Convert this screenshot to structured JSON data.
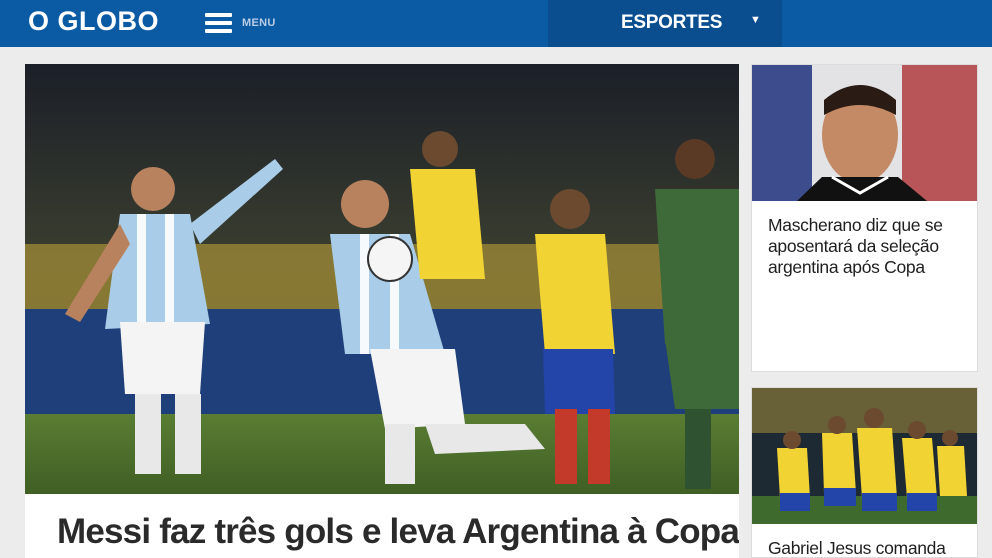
{
  "header": {
    "logo": "O GLOBO",
    "menu_label": "MENU",
    "section_label": "ESPORTES",
    "section_arrow": "▼",
    "colors": {
      "bar": "#0b5aa4",
      "section": "#0a4e90"
    }
  },
  "hero": {
    "title": "Messi faz três gols e leva Argentina à Copa",
    "image": "argentina-players-celebrating-photo"
  },
  "side_stories": [
    {
      "title": "Mascherano diz que se aposentará da seleção argentina após Copa",
      "image": "mascherano-portrait-photo"
    },
    {
      "title": "Gabriel Jesus comanda",
      "image": "brazil-players-celebrating-photo"
    }
  ]
}
